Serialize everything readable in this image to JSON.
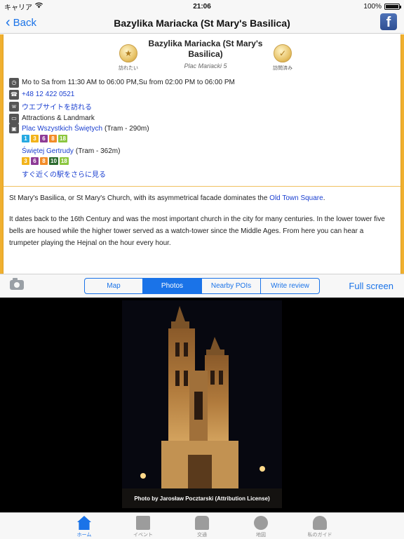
{
  "status": {
    "carrier": "キャリア",
    "time": "21:06",
    "battery": "100%"
  },
  "nav": {
    "back_label": "Back",
    "title": "Bazylika Mariacka (St Mary's Basilica)"
  },
  "poi": {
    "title": "Bazylika Mariacka (St Mary's Basilica)",
    "address": "Plac Mariacki 5",
    "badge_left": "訪れたい",
    "badge_right": "訪問済み",
    "hours": "Mo to Sa from 11:30 AM to 06:00 PM,Su from 02:00 PM to 06:00 PM",
    "phone": "+48 12 422 0521",
    "website": "ウエブサイトを訪れる",
    "category": "Attractions & Landmark",
    "stops": [
      {
        "name": "Plac Wszystkich Świętych",
        "dist": " (Tram - 290m)",
        "lines": [
          {
            "n": "1",
            "color": "#27a9e1"
          },
          {
            "n": "3",
            "color": "#f2b31b"
          },
          {
            "n": "6",
            "color": "#8e3b96"
          },
          {
            "n": "8",
            "color": "#f28c28"
          },
          {
            "n": "18",
            "color": "#8cc63f"
          }
        ]
      },
      {
        "name": "Świętej Gertrudy",
        "dist": " (Tram - 362m)",
        "lines": [
          {
            "n": "3",
            "color": "#f2b31b"
          },
          {
            "n": "6",
            "color": "#8e3b96"
          },
          {
            "n": "8",
            "color": "#f28c28"
          },
          {
            "n": "10",
            "color": "#2c6b2f"
          },
          {
            "n": "18",
            "color": "#8cc63f"
          }
        ]
      }
    ],
    "more_stations": "すぐ近くの駅をさらに見る"
  },
  "description": {
    "p1_before": "St Mary's Basilica, or St Mary's Church, with its asymmetrical facade dominates the ",
    "p1_link": "Old Town Square",
    "p1_after": ".",
    "p2": "It dates back to the 16th Century and was the most important church in the city for many centuries. In the lower tower five bells are housed while the higher tower served as a watch-tower since the Middle Ages. From here you can hear a trumpeter playing the Hejnal on the hour every hour."
  },
  "toolbar": {
    "segments": [
      "Map",
      "Photos",
      "Nearby POIs",
      "Write review"
    ],
    "active": "Photos",
    "fullscreen": "Full screen"
  },
  "photo": {
    "caption": "Photo by Jarosław Pocztarski (Attribution License)"
  },
  "tabs": [
    {
      "label": "ホーム",
      "icon": "home-icon",
      "active": true
    },
    {
      "label": "イベント",
      "icon": "calendar-icon",
      "active": false
    },
    {
      "label": "交通",
      "icon": "train-icon",
      "active": false
    },
    {
      "label": "地図",
      "icon": "globe-icon",
      "active": false
    },
    {
      "label": "私のガイド",
      "icon": "person-icon",
      "active": false
    }
  ]
}
